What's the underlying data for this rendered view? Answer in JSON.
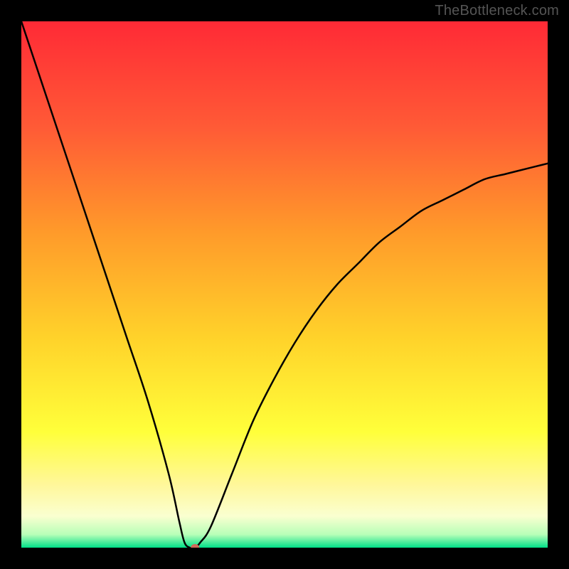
{
  "watermark": "TheBottleneck.com",
  "chart_data": {
    "type": "line",
    "title": "",
    "xlabel": "",
    "ylabel": "",
    "xlim": [
      0,
      100
    ],
    "ylim": [
      0,
      100
    ],
    "x_optimum": 32,
    "curve": {
      "x": [
        0,
        4,
        8,
        12,
        16,
        20,
        24,
        28,
        30,
        31,
        32,
        33,
        34,
        36,
        40,
        44,
        48,
        52,
        56,
        60,
        64,
        68,
        72,
        76,
        80,
        84,
        88,
        92,
        96,
        100
      ],
      "y": [
        100,
        88,
        76,
        64,
        52,
        40,
        28,
        14,
        5,
        1,
        0,
        0,
        1,
        4,
        14,
        24,
        32,
        39,
        45,
        50,
        54,
        58,
        61,
        64,
        66,
        68,
        70,
        71,
        72,
        73
      ]
    },
    "marker": {
      "x": 33,
      "y": 0,
      "color": "#d06a5a",
      "radius_px": 6
    },
    "gradient_stops": [
      {
        "offset": 0.0,
        "color": "#ff2a36"
      },
      {
        "offset": 0.2,
        "color": "#ff5a36"
      },
      {
        "offset": 0.4,
        "color": "#ff9a2a"
      },
      {
        "offset": 0.6,
        "color": "#ffd22a"
      },
      {
        "offset": 0.78,
        "color": "#ffff3a"
      },
      {
        "offset": 0.88,
        "color": "#fff79a"
      },
      {
        "offset": 0.94,
        "color": "#faffd0"
      },
      {
        "offset": 0.975,
        "color": "#b8ffb8"
      },
      {
        "offset": 1.0,
        "color": "#00e088"
      }
    ],
    "curve_stroke": "#000000",
    "curve_stroke_width": 2.5
  }
}
